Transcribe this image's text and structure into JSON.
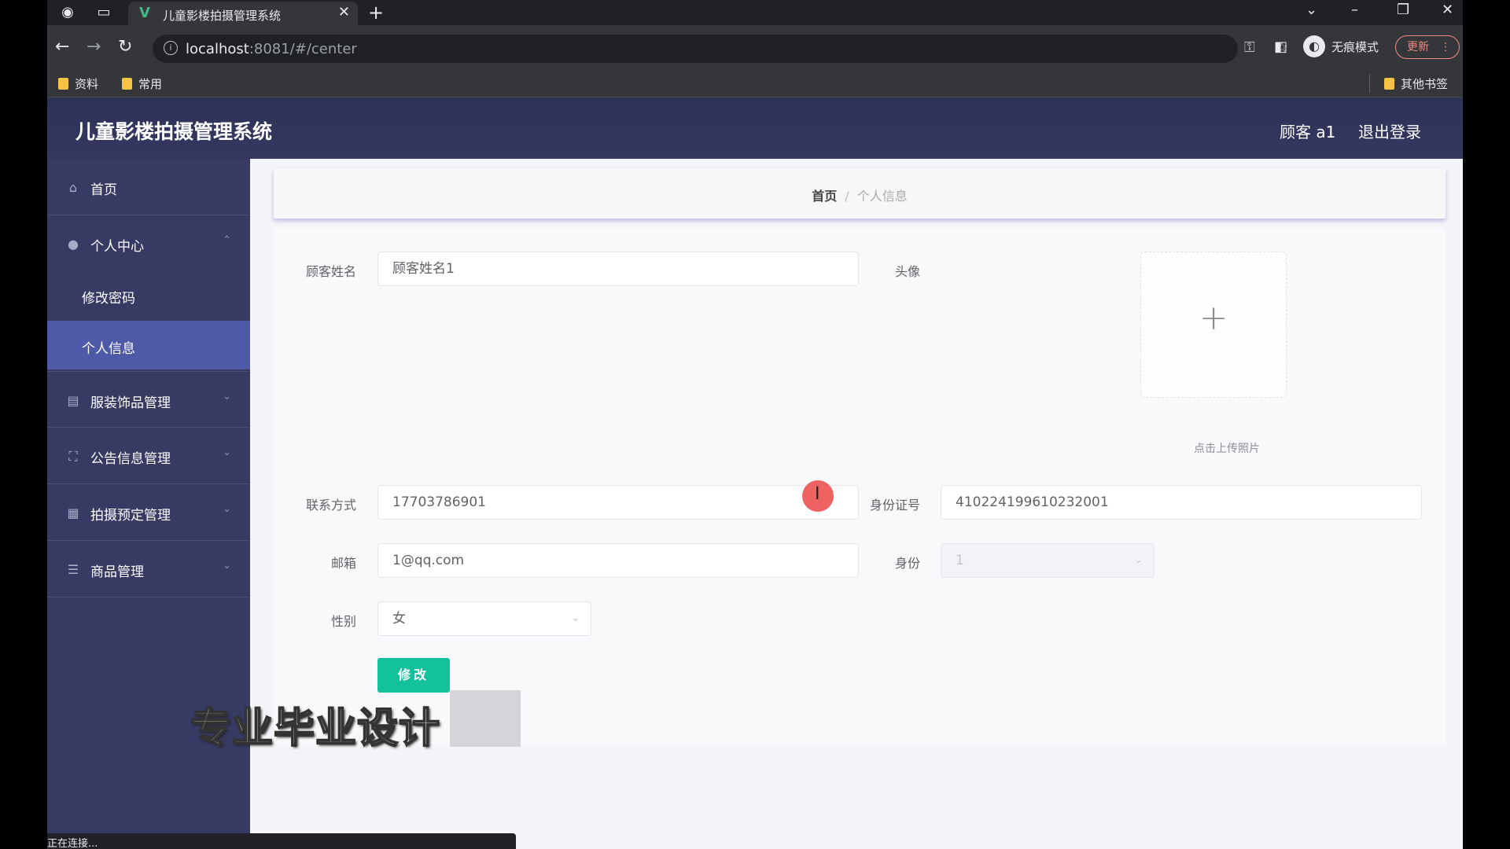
{
  "browser": {
    "tab_title": "儿童影楼拍摄管理系统",
    "url_host": "localhost",
    "url_rest": ":8081/#/center",
    "incognito_label": "无痕模式",
    "update_label": "更新",
    "bookmarks": [
      "资料",
      "常用"
    ],
    "other_bookmarks": "其他书签",
    "status_text": "正在连接..."
  },
  "app": {
    "title": "儿童影楼拍摄管理系统",
    "user": "顾客 a1",
    "logout": "退出登录"
  },
  "sidebar": {
    "home": "首页",
    "personal_center": "个人中心",
    "change_password": "修改密码",
    "personal_info": "个人信息",
    "clothing_mgmt": "服装饰品管理",
    "notice_mgmt": "公告信息管理",
    "booking_mgmt": "拍摄预定管理",
    "product_mgmt": "商品管理"
  },
  "breadcrumb": {
    "home": "首页",
    "separator": "/",
    "current": "个人信息"
  },
  "form": {
    "name_label": "顾客姓名",
    "name_value": "顾客姓名1",
    "avatar_label": "头像",
    "upload_plus": "+",
    "upload_tip": "点击上传照片",
    "phone_label": "联系方式",
    "phone_value": "17703786901",
    "id_label": "身份证号",
    "id_value": "410224199610232001",
    "email_label": "邮箱",
    "email_value": "1@qq.com",
    "identity_label": "身份",
    "identity_value": "1",
    "gender_label": "性别",
    "gender_value": "女",
    "submit_label": "修改"
  },
  "overlay": {
    "watermark": "专业毕业设计"
  },
  "colors": {
    "header_bg": "#2f3257",
    "sidebar_bg": "#373a63",
    "sidebar_active": "#4e5aa7",
    "submit_bg": "#13c29a"
  },
  "icons": {
    "home": "home-icon",
    "user": "user-icon",
    "clothing": "clipboard-icon",
    "notice": "frame-icon",
    "booking": "grid-icon",
    "product": "shelf-icon"
  }
}
